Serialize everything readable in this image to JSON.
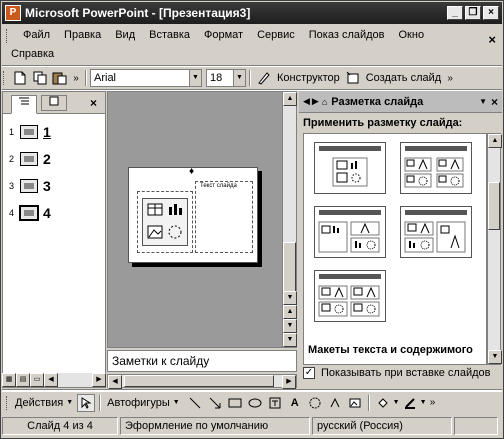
{
  "window": {
    "app_icon": "P",
    "title": "Microsoft PowerPoint - [Презентация3]",
    "btn_minimize": "_",
    "btn_restore": "❐",
    "btn_close": "×"
  },
  "menu": {
    "items": [
      "Файл",
      "Правка",
      "Вид",
      "Вставка",
      "Формат",
      "Сервис",
      "Показ слайдов",
      "Окно"
    ],
    "help": "Справка",
    "close_doc": "×"
  },
  "toolbar": {
    "font": "Arial",
    "font_size": "18",
    "designer": "Конструктор",
    "new_slide": "Создать слайд",
    "more": "»"
  },
  "outline_pane": {
    "close": "×",
    "slides": [
      {
        "num": "1",
        "label": "1"
      },
      {
        "num": "2",
        "label": "2"
      },
      {
        "num": "3",
        "label": "3"
      },
      {
        "num": "4",
        "label": "4"
      }
    ]
  },
  "slide": {
    "text_placeholder": "Текст слайда"
  },
  "notes": {
    "placeholder": "Заметки к слайду"
  },
  "task_pane": {
    "title": "Разметка слайда",
    "subtitle": "Применить разметку слайда:",
    "section_label": "Макеты текста и содержимого",
    "show_on_insert": "Показывать при вставке слайдов",
    "show_on_insert_checked": true,
    "close": "×"
  },
  "drawing_toolbar": {
    "actions": "Действия",
    "autoshapes": "Автофигуры"
  },
  "status": {
    "slide": "Слайд 4 из 4",
    "design": "Эформление по умолчанию",
    "language": "русский (Россия)"
  }
}
